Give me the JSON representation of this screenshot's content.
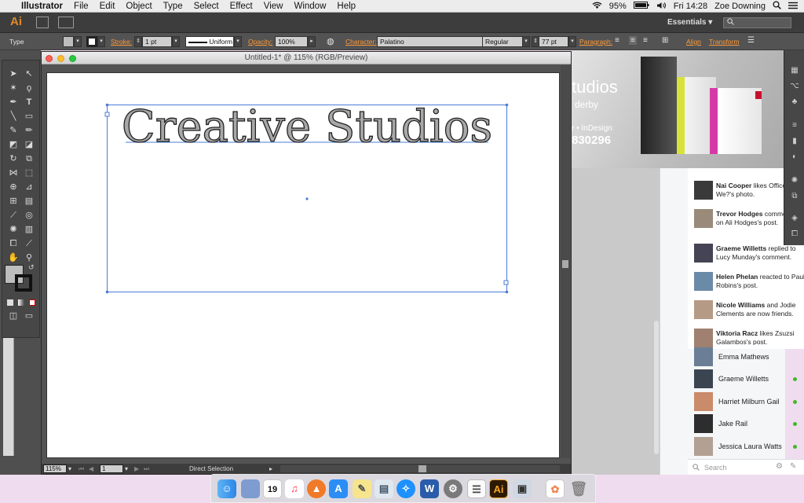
{
  "menubar": {
    "apple": "",
    "app_name": "Illustrator",
    "items": [
      "File",
      "Edit",
      "Object",
      "Type",
      "Select",
      "Effect",
      "View",
      "Window",
      "Help"
    ],
    "battery": "95%",
    "time": "Fri 14:28",
    "user": "Zoe Downing"
  },
  "appbar": {
    "logo": "Ai",
    "workspace": "Essentials"
  },
  "control": {
    "tool_type": "Type",
    "stroke_label": "Stroke:",
    "stroke_value": "1 pt",
    "stroke_profile": "Uniform",
    "opacity_label": "Opacity:",
    "opacity_value": "100%",
    "character_label": "Character:",
    "font_family": "Palatino",
    "font_style": "Regular",
    "font_size": "77 pt",
    "paragraph_label": "Paragraph:",
    "align_label": "Align",
    "transform_label": "Transform"
  },
  "document": {
    "title": "Untitled-1* @ 115% (RGB/Preview)",
    "artwork_text": "Creative Studios"
  },
  "statusbar": {
    "zoom": "115%",
    "artboard": "1",
    "tool_status": "Direct Selection"
  },
  "ad": {
    "line1": "tudios",
    "line2": "derby",
    "line3": "r • InDesign",
    "line4": "830296"
  },
  "notifications": [
    {
      "name": "Nai Cooper",
      "text": "likes Office Are We?'s photo."
    },
    {
      "name": "Trevor Hodges",
      "text": "commented on Ali Hodges's post."
    },
    {
      "name": "Graeme Willetts",
      "text": "replied to Lucy Munday's comment."
    },
    {
      "name": "Helen Phelan",
      "text": "reacted to Paul Robins's post."
    },
    {
      "name": "Nicole Williams",
      "text": "and Jodie Clements are now friends."
    },
    {
      "name": "Viktoria Racz",
      "text": "likes Zsuzsi Galambos's post."
    }
  ],
  "chat": {
    "contacts": [
      "Emma Mathews",
      "Graeme Willetts",
      "Harriet Milburn Gail",
      "Jake Rail",
      "Jessica Laura Watts"
    ],
    "search_placeholder": "Search"
  },
  "dock": {
    "calendar_day": "19",
    "word_letter": "W",
    "ai_letter": "Ai"
  },
  "colors": {
    "accent_orange": "#ff9a3a",
    "online_green": "#42b72a",
    "bounding_blue": "#4a7bd6"
  }
}
